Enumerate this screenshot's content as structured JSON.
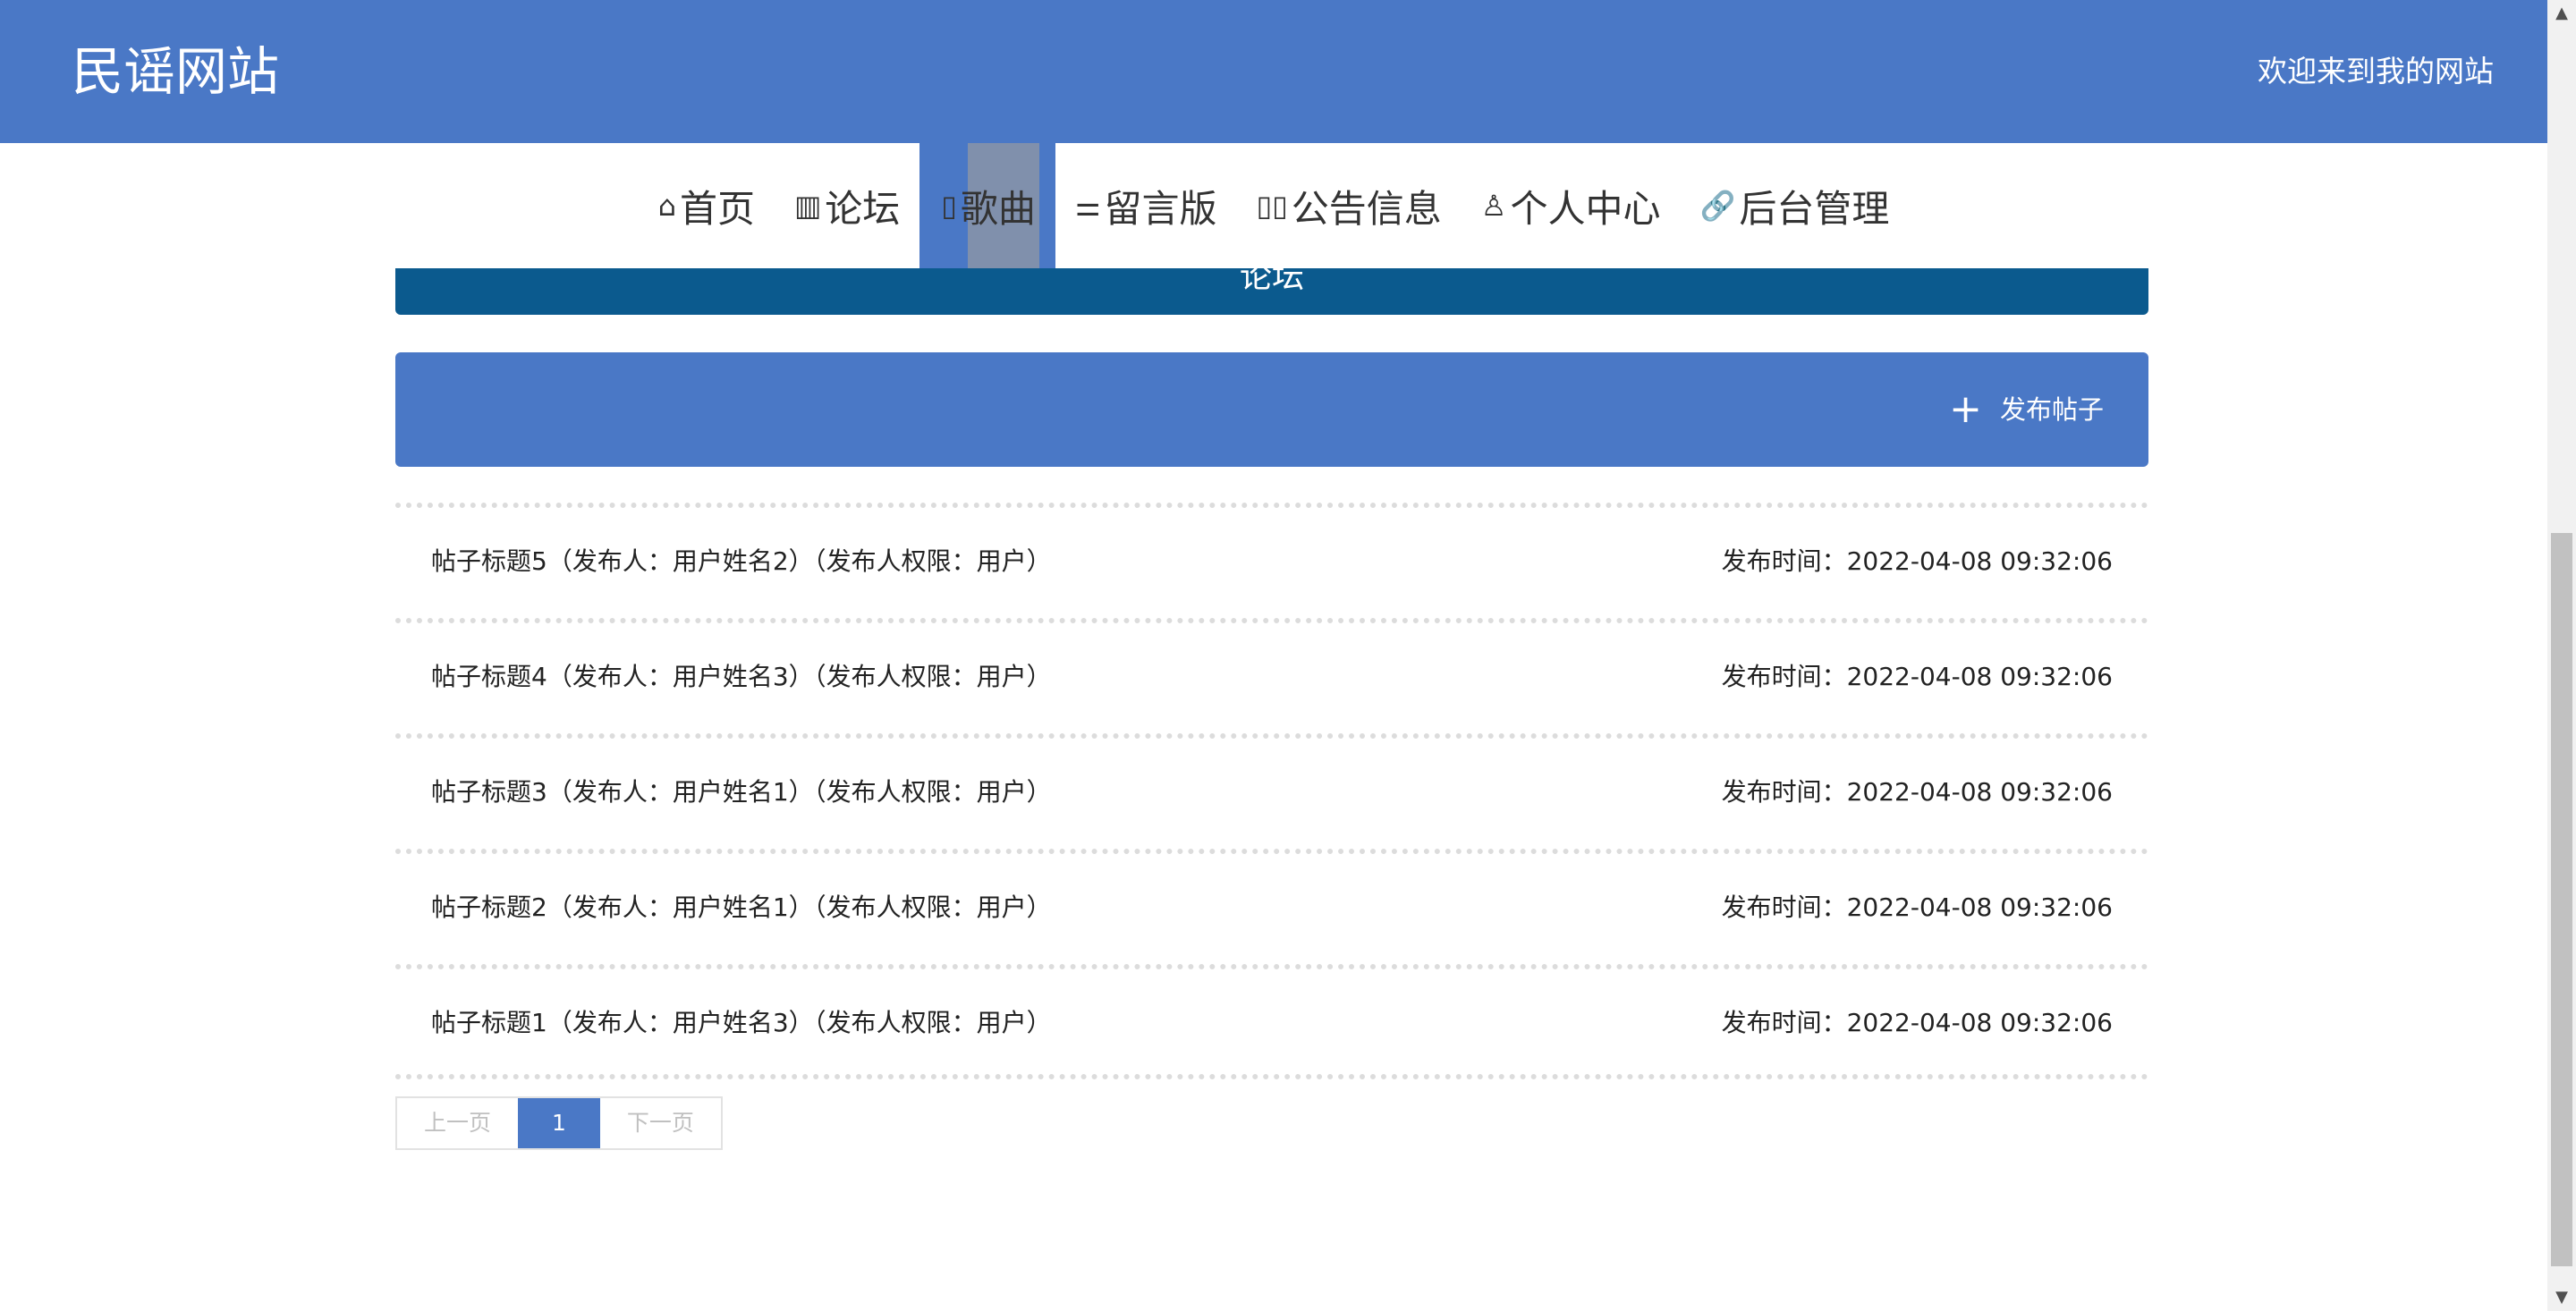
{
  "header": {
    "site_title": "民谣网站",
    "welcome": "欢迎来到我的网站"
  },
  "nav": {
    "items": [
      {
        "icon": "home-icon",
        "glyph": "⌂",
        "label": "首页"
      },
      {
        "icon": "grid-icon",
        "glyph": "▥",
        "label": "论坛"
      },
      {
        "icon": "note-icon",
        "glyph": "▯",
        "label": "歌曲",
        "active": true
      },
      {
        "icon": "sliders-icon",
        "glyph": "⚌",
        "label": "留言版"
      },
      {
        "icon": "columns-icon",
        "glyph": "▯▯",
        "label": "公告信息"
      },
      {
        "icon": "user-icon",
        "glyph": "♙",
        "label": "个人中心"
      },
      {
        "icon": "link-icon",
        "glyph": "🔗",
        "label": "后台管理"
      }
    ]
  },
  "forum": {
    "banner_title": "论坛",
    "post_button": {
      "icon": "plus-icon",
      "glyph": "+",
      "label": "发布帖子"
    },
    "posts": [
      {
        "title": "帖子标题5（发布人：用户姓名2）（发布人权限：用户）",
        "time": "发布时间：2022-04-08 09:32:06"
      },
      {
        "title": "帖子标题4（发布人：用户姓名3）（发布人权限：用户）",
        "time": "发布时间：2022-04-08 09:32:06"
      },
      {
        "title": "帖子标题3（发布人：用户姓名1）（发布人权限：用户）",
        "time": "发布时间：2022-04-08 09:32:06"
      },
      {
        "title": "帖子标题2（发布人：用户姓名1）（发布人权限：用户）",
        "time": "发布时间：2022-04-08 09:32:06"
      },
      {
        "title": "帖子标题1（发布人：用户姓名3）（发布人权限：用户）",
        "time": "发布时间：2022-04-08 09:32:06"
      }
    ]
  },
  "pagination": {
    "prev": "上一页",
    "current": "1",
    "next": "下一页"
  },
  "colors": {
    "header_bg": "#4a78c6",
    "banner_bg": "#0b5a8e",
    "active_highlight": "#8090ac"
  }
}
